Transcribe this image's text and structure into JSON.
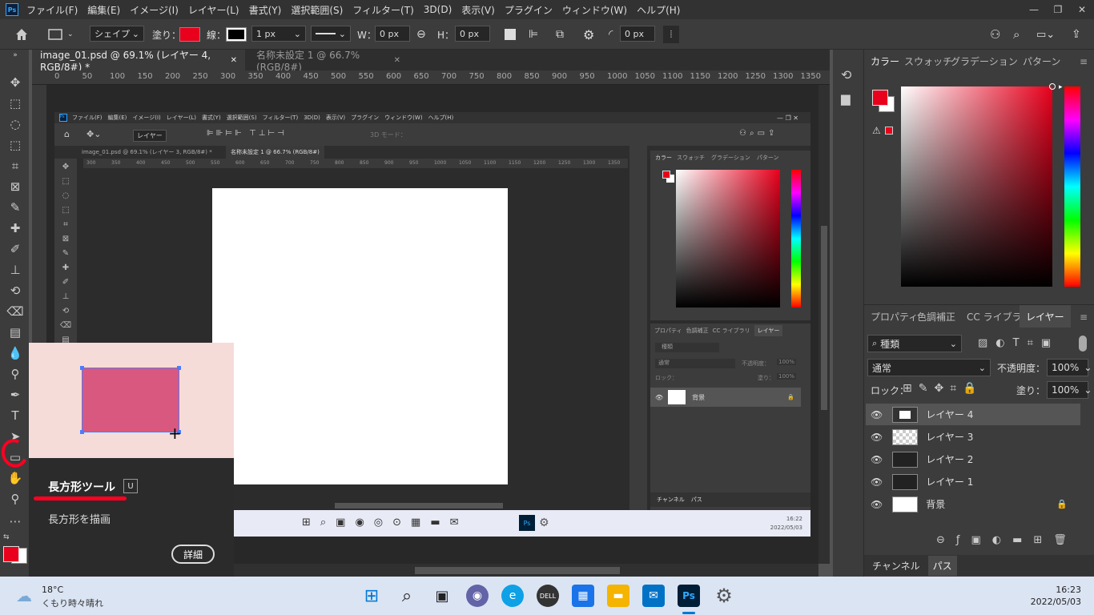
{
  "app": {
    "logo": "Ps",
    "menu": [
      "ファイル(F)",
      "編集(E)",
      "イメージ(I)",
      "レイヤー(L)",
      "書式(Y)",
      "選択範囲(S)",
      "フィルター(T)",
      "3D(D)",
      "表示(V)",
      "プラグイン",
      "ウィンドウ(W)",
      "ヘルプ(H)"
    ],
    "window_buttons": [
      "—",
      "❐",
      "✕"
    ]
  },
  "options": {
    "home_icon": "home-icon",
    "shape_mode": "シェイプ",
    "fill_label": "塗り：",
    "fill_color": "#e8001c",
    "stroke_label": "線：",
    "stroke_width": "1 px",
    "w_label": "W：",
    "w_value": "0 px",
    "h_label": "H：",
    "h_value": "0 px",
    "radius_value": "0 px"
  },
  "tabs": [
    {
      "label": "image_01.psd @ 69.1% (レイヤー 4, RGB/8#) *",
      "active": true
    },
    {
      "label": "名称未設定 1 @ 66.7% (RGB/8#)",
      "active": false
    }
  ],
  "ruler": [
    "0",
    "50",
    "100",
    "150",
    "200",
    "250",
    "300",
    "350",
    "400",
    "450",
    "500",
    "550",
    "600",
    "650",
    "700",
    "750",
    "800",
    "850",
    "900",
    "950",
    "1000",
    "1050",
    "1100",
    "1150",
    "1200",
    "1250",
    "1300",
    "1350"
  ],
  "inner": {
    "menu": [
      "ファイル(F)",
      "編集(E)",
      "イメージ(I)",
      "レイヤー(L)",
      "書式(Y)",
      "選択範囲(S)",
      "フィルター(T)",
      "3D(D)",
      "表示(V)",
      "プラグイン",
      "ウィンドウ(W)",
      "ヘルプ(H)"
    ],
    "layer_select": "レイヤー",
    "mode_3d": "3D モード：",
    "tab1": "image_01.psd @ 69.1% (レイヤー 3, RGB/8#) *",
    "tab2": "名称未設定 1 @ 66.7% (RGB/8#)",
    "ruler": [
      "300",
      "350",
      "400",
      "450",
      "500",
      "550",
      "600",
      "650",
      "700",
      "750",
      "800",
      "850",
      "900",
      "950",
      "1000",
      "1050",
      "1100",
      "1150",
      "1200",
      "1250",
      "1300",
      "1350"
    ],
    "color_tabs": [
      "カラー",
      "スウォッチ",
      "グラデーション",
      "パターン"
    ],
    "layer_tabs": [
      "プロパティ",
      "色調補正",
      "CC ライブラリ",
      "レイヤー"
    ],
    "search": "種類",
    "blend": "通常",
    "opacity_label": "不透明度：",
    "opacity": "100%",
    "lock": "ロック：",
    "fill_label": "塗り：",
    "fill": "100%",
    "layer_bg": "背景",
    "bottom_tabs": [
      "チャンネル",
      "パス"
    ],
    "clock_time": "16:22",
    "clock_date": "2022/05/03"
  },
  "color_panel": {
    "tabs": [
      "カラー",
      "スウォッチ",
      "グラデーション",
      "パターン"
    ],
    "fg": "#e8001c",
    "bg": "#ffffff",
    "hue": "#e8001c"
  },
  "layers_panel": {
    "tabs": [
      "プロパティ",
      "色調補正",
      "CC ライブラリ",
      "レイヤー"
    ],
    "filter": "種類",
    "blend": "通常",
    "opacity_label": "不透明度：",
    "opacity": "100%",
    "lock_label": "ロック：",
    "fill_label": "塗り：",
    "fill": "100%",
    "layers": [
      {
        "name": "レイヤー 4",
        "selected": true
      },
      {
        "name": "レイヤー 3",
        "selected": false
      },
      {
        "name": "レイヤー 2",
        "selected": false
      },
      {
        "name": "レイヤー 1",
        "selected": false
      },
      {
        "name": "背景",
        "selected": false,
        "locked": true
      }
    ],
    "bottom_tabs": [
      "チャンネル",
      "パス"
    ]
  },
  "tooltip": {
    "title": "長方形ツール",
    "shortcut": "U",
    "desc": "長方形を描画",
    "more": "詳細",
    "preview_rect_color": "#d9587f",
    "highlight_color": "#ff0022"
  },
  "taskbar": {
    "weather_temp": "18°C",
    "weather_desc": "くもり時々晴れ",
    "time": "16:23",
    "date": "2022/05/03"
  }
}
